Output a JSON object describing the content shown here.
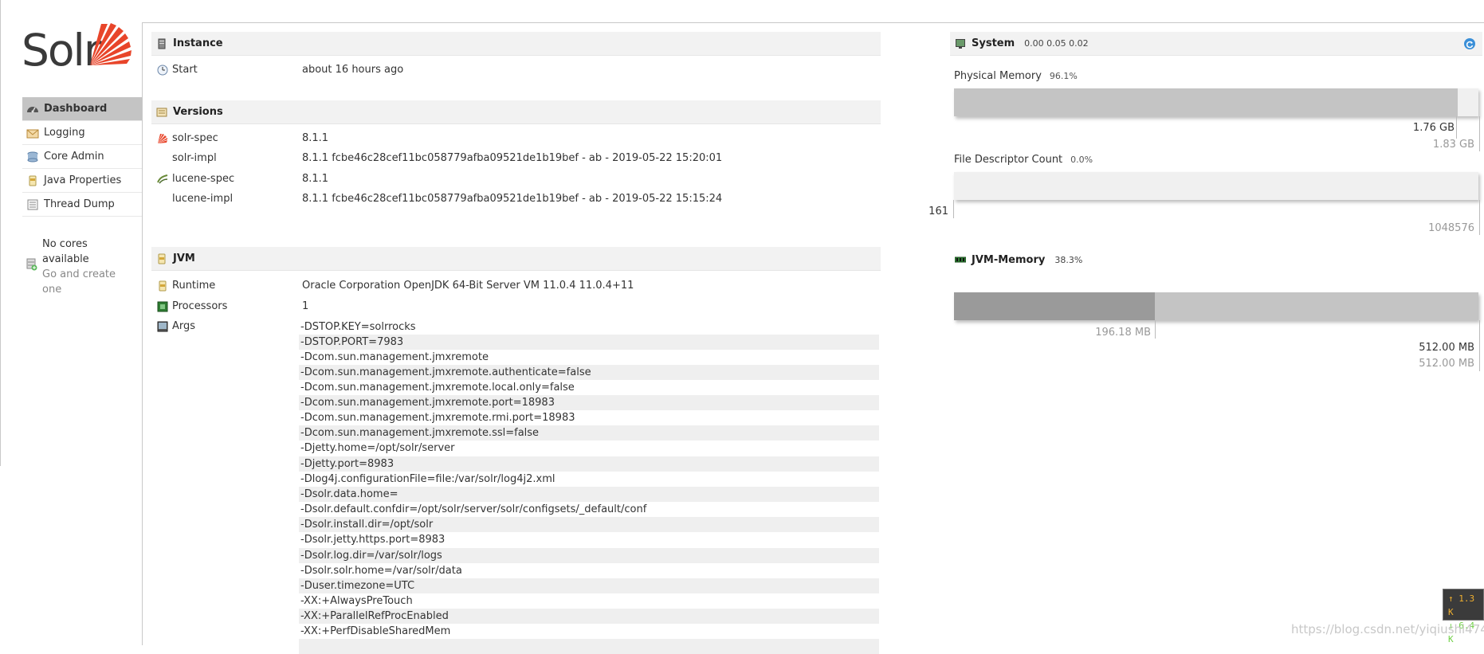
{
  "logo": {
    "text": "Solr"
  },
  "nav": {
    "items": [
      {
        "label": "Dashboard",
        "icon": "dashboard-icon",
        "active": true
      },
      {
        "label": "Logging",
        "icon": "logging-icon"
      },
      {
        "label": "Core Admin",
        "icon": "core-admin-icon"
      },
      {
        "label": "Java Properties",
        "icon": "java-properties-icon"
      },
      {
        "label": "Thread Dump",
        "icon": "thread-dump-icon"
      }
    ],
    "no_cores": {
      "line1": "No cores",
      "line2": "available",
      "link1": "Go and create",
      "link2": "one"
    }
  },
  "instance": {
    "title": "Instance",
    "start_label": "Start",
    "start_value": "about 16 hours ago"
  },
  "versions": {
    "title": "Versions",
    "rows": [
      {
        "label": "solr-spec",
        "value": "8.1.1"
      },
      {
        "label": "solr-impl",
        "value": "8.1.1 fcbe46c28cef11bc058779afba09521de1b19bef - ab - 2019-05-22 15:20:01"
      },
      {
        "label": "lucene-spec",
        "value": "8.1.1"
      },
      {
        "label": "lucene-impl",
        "value": "8.1.1 fcbe46c28cef11bc058779afba09521de1b19bef - ab - 2019-05-22 15:15:24"
      }
    ]
  },
  "jvm": {
    "title": "JVM",
    "runtime_label": "Runtime",
    "runtime_value": "Oracle Corporation OpenJDK 64-Bit Server VM 11.0.4 11.0.4+11",
    "processors_label": "Processors",
    "processors_value": "1",
    "args_label": "Args",
    "args": [
      "-DSTOP.KEY=solrrocks",
      "-DSTOP.PORT=7983",
      "-Dcom.sun.management.jmxremote",
      "-Dcom.sun.management.jmxremote.authenticate=false",
      "-Dcom.sun.management.jmxremote.local.only=false",
      "-Dcom.sun.management.jmxremote.port=18983",
      "-Dcom.sun.management.jmxremote.rmi.port=18983",
      "-Dcom.sun.management.jmxremote.ssl=false",
      "-Djetty.home=/opt/solr/server",
      "-Djetty.port=8983",
      "-Dlog4j.configurationFile=file:/var/solr/log4j2.xml",
      "-Dsolr.data.home=",
      "-Dsolr.default.confdir=/opt/solr/server/solr/configsets/_default/conf",
      "-Dsolr.install.dir=/opt/solr",
      "-Dsolr.jetty.https.port=8983",
      "-Dsolr.log.dir=/var/solr/logs",
      "-Dsolr.solr.home=/var/solr/data",
      "-Duser.timezone=UTC",
      "-XX:+AlwaysPreTouch",
      "-XX:+ParallelRefProcEnabled",
      "-XX:+PerfDisableSharedMem"
    ]
  },
  "system": {
    "title": "System",
    "load": "0.00 0.05 0.02",
    "physical_memory": {
      "label": "Physical Memory",
      "pct": "96.1%",
      "fraction": 0.961,
      "used": "1.76 GB",
      "total": "1.83 GB"
    },
    "file_descriptor": {
      "label": "File Descriptor Count",
      "pct": "0.0%",
      "fraction": 0.0,
      "used": "161",
      "max": "1048576"
    }
  },
  "jvm_memory": {
    "title": "JVM-Memory",
    "pct": "38.3%",
    "used_fraction": 0.383,
    "used": "196.18 MB",
    "total": "512.00 MB",
    "max": "512.00 MB"
  },
  "network": {
    "up": "↑ 1.3 K",
    "down": "↓ 6.4 K"
  },
  "watermark": "https://blog.csdn.net/yiqiushi4748",
  "colors": {
    "active_nav": "#c4c4c4",
    "bar_bg": "#f0f0f0",
    "phys_fill": "#c4c4c4",
    "jvm_used": "#9a9a9a",
    "jvm_total": "#c4c4c4",
    "refresh": "#3a8fd8"
  }
}
